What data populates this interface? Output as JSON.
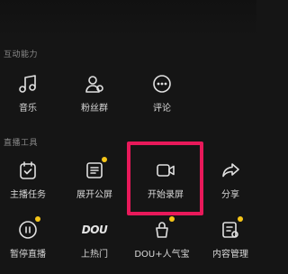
{
  "sections": {
    "interaction": {
      "title": "互动能力"
    },
    "live_tools": {
      "title": "直播工具"
    }
  },
  "interaction_items": [
    {
      "label": "音乐",
      "icon": "music-icon"
    },
    {
      "label": "粉丝群",
      "icon": "fans-group-icon"
    },
    {
      "label": "评论",
      "icon": "comment-icon"
    }
  ],
  "tool_items": [
    {
      "label": "主播任务",
      "icon": "task-calendar-icon"
    },
    {
      "label": "展开公屏",
      "icon": "public-screen-icon",
      "badge": true
    },
    {
      "label": "开始录屏",
      "icon": "record-camera-icon",
      "highlighted": true
    },
    {
      "label": "分享",
      "icon": "share-icon"
    }
  ],
  "bottom_items": [
    {
      "label": "暂停直播",
      "icon": "pause-icon",
      "badge": true
    },
    {
      "label": "上热门",
      "icon": "dou-logo-icon",
      "logo_text": "DOU"
    },
    {
      "label": "DOU+人气宝",
      "icon": "popularity-icon",
      "badge": true
    },
    {
      "label": "内容管理",
      "icon": "content-manage-icon",
      "badge": true
    }
  ],
  "colors": {
    "background": "#151515",
    "highlight_border": "#e8195a",
    "badge": "#f5c518"
  }
}
